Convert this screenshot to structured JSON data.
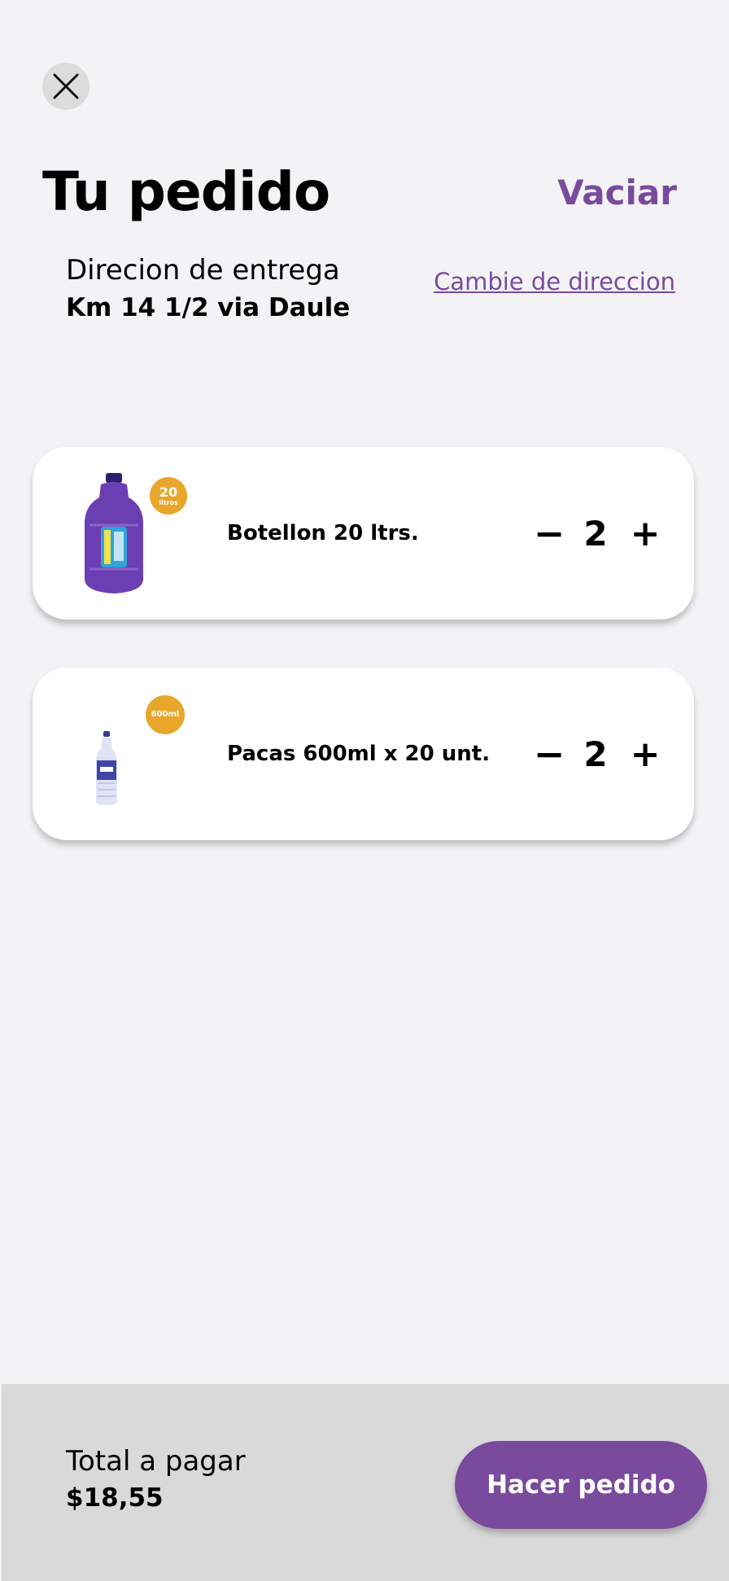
{
  "header": {
    "title": "Tu pedido",
    "clear_label": "Vaciar",
    "close_icon": "close-icon"
  },
  "address": {
    "label": "Direcion de entrega",
    "value": "Km 14 1/2 via Daule",
    "change_label": "Cambie de direccion"
  },
  "items": [
    {
      "name": "Botellon 20 ltrs.",
      "quantity": "2",
      "badge_main": "20",
      "badge_sub": "litros",
      "minus": "−",
      "plus": "+"
    },
    {
      "name": "Pacas 600ml x 20 unt.",
      "quantity": "2",
      "badge_main": "600ml",
      "minus": "−",
      "plus": "+"
    }
  ],
  "footer": {
    "total_label": "Total a pagar",
    "total_value": "$18,55",
    "order_label": "Hacer pedido"
  },
  "colors": {
    "accent": "#7a4a9d",
    "badge": "#e8a62a",
    "background": "#f3f3f6",
    "footer_bg": "#d9d9d9"
  }
}
